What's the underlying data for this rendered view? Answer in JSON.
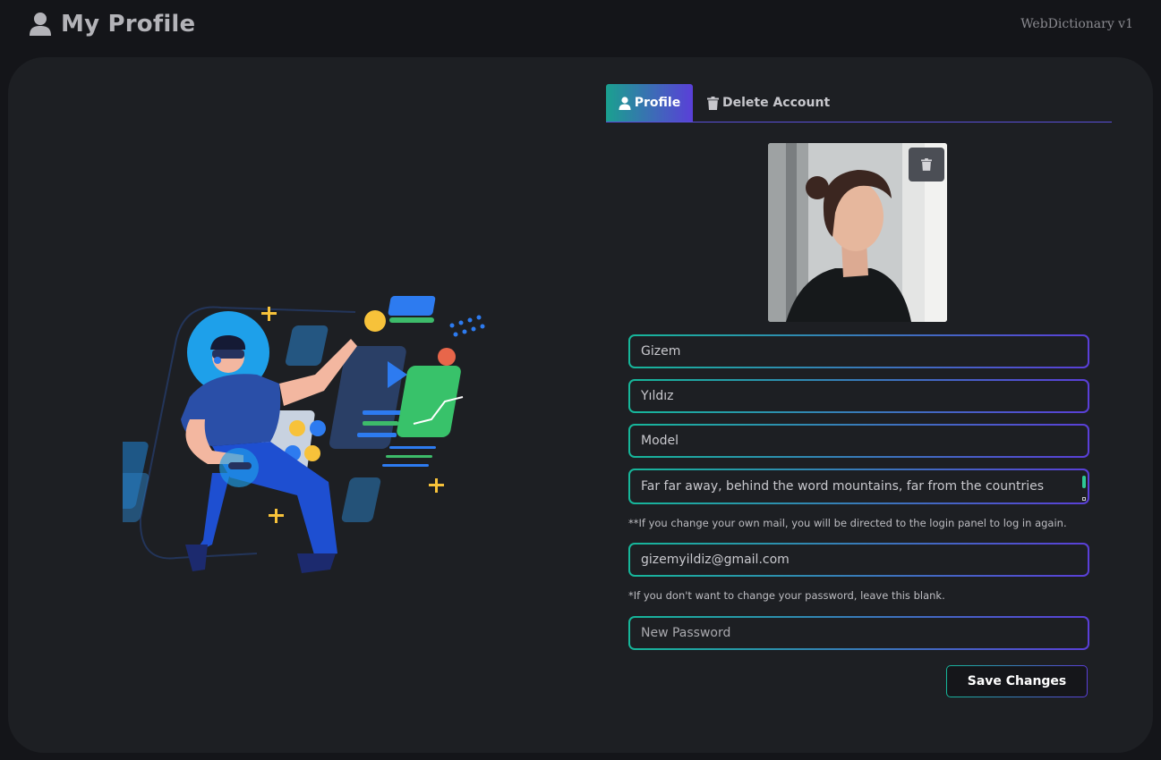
{
  "header": {
    "title": "My Profile",
    "brand": "WebDictionary v1"
  },
  "tabs": [
    {
      "label": "Profile",
      "icon": "user-icon",
      "active": true
    },
    {
      "label": "Delete Account",
      "icon": "trash-icon",
      "active": false
    }
  ],
  "form": {
    "first_name": "Gizem",
    "last_name": "Yıldız",
    "job": "Model",
    "about": "Far far away, behind the word mountains, far from the countries",
    "email_note": "**If you change your own mail, you will be directed to the login panel to log in again.",
    "email": "gizemyildiz@gmail.com",
    "password_note": "*If you don't want to change your password, leave this blank.",
    "password_placeholder": "New Password",
    "save_label": "Save Changes"
  },
  "colors": {
    "accent_start": "#16b79a",
    "accent_end": "#5a3fd8",
    "card": "#1d1f23",
    "background": "#141519"
  }
}
